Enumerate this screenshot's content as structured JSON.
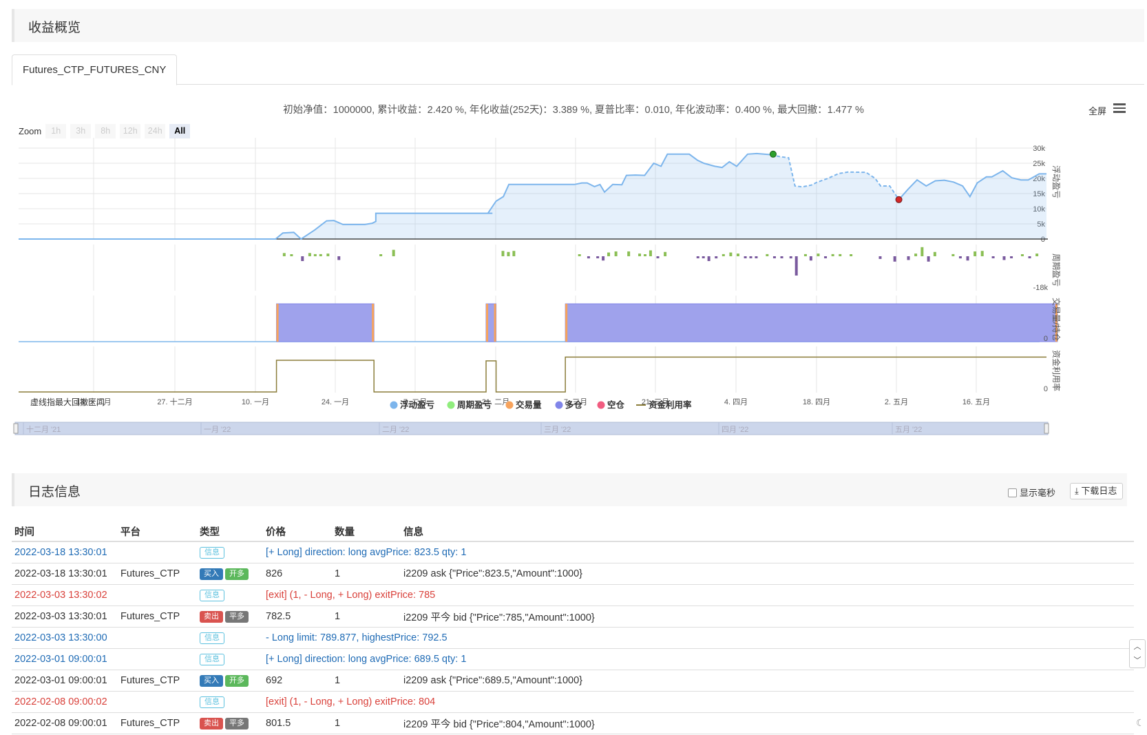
{
  "summary": {
    "title": "收益概览",
    "tab": "Futures_CTP_FUTURES_CNY",
    "stats": "初始净值：1000000, 累计收益：2.420 %, 年化收益(252天)：3.389 %, 夏普比率：0.010, 年化波动率：0.400 %, 最大回撤：1.477 %",
    "fullscreen": "全屏"
  },
  "zoom": {
    "label": "Zoom",
    "buttons": [
      "1h",
      "3h",
      "8h",
      "12h",
      "24h",
      "All"
    ],
    "active": "All"
  },
  "chart_data": {
    "type": "line",
    "x_ticks": [
      "13. 十二月",
      "27. 十二月",
      "10. 一月",
      "24. 一月",
      "7. 二月",
      "21. 二月",
      "7. 三月",
      "21. 三月",
      "4. 四月",
      "18. 四月",
      "2. 五月",
      "16. 五月"
    ],
    "navigator_ticks": [
      "十二月 '21",
      "一月 '22",
      "二月 '22",
      "三月 '22",
      "四月 '22",
      "五月 '22"
    ],
    "panes": [
      {
        "name": "浮动盈亏",
        "y_ticks": [
          "30k",
          "25k",
          "20k",
          "15k",
          "10k",
          "5k",
          "0"
        ],
        "ylim": [
          0,
          30000
        ]
      },
      {
        "name": "周期盈亏",
        "y_ticks": [
          "-18k"
        ]
      },
      {
        "name": "交易量/持仓",
        "y_ticks": [
          "0"
        ]
      },
      {
        "name": "资金利用率",
        "y_ticks": [
          "0"
        ]
      }
    ],
    "legend": [
      "浮动盈亏",
      "周期盈亏",
      "交易量",
      "多仓",
      "空仓",
      "资金利用率"
    ],
    "legend_colors": [
      "#7cb5ec",
      "#90ed7d",
      "#f7a35c",
      "#8085e9",
      "#f15c80",
      "#8b7d3a"
    ],
    "drawdown_note": "虚线指最大回撤区间",
    "floating_pnl": [
      [
        0.0,
        0
      ],
      [
        0.282,
        0
      ],
      [
        0.29,
        2000
      ],
      [
        0.302,
        2200
      ],
      [
        0.31,
        0
      ],
      [
        0.325,
        3000
      ],
      [
        0.338,
        6000
      ],
      [
        0.346,
        6100
      ],
      [
        0.356,
        4800
      ],
      [
        0.38,
        4800
      ],
      [
        0.388,
        5200
      ],
      [
        0.392,
        5800
      ],
      [
        0.392,
        8500
      ],
      [
        0.52,
        8500
      ],
      [
        0.515,
        8500
      ],
      [
        0.524,
        12500
      ],
      [
        0.532,
        14000
      ],
      [
        0.538,
        18000
      ],
      [
        0.61,
        18000
      ],
      [
        0.618,
        18500
      ],
      [
        0.624,
        18500
      ],
      [
        0.632,
        17300
      ],
      [
        0.638,
        18000
      ],
      [
        0.643,
        15500
      ],
      [
        0.652,
        18000
      ],
      [
        0.662,
        17900
      ],
      [
        0.667,
        21000
      ],
      [
        0.677,
        21100
      ],
      [
        0.687,
        21000
      ],
      [
        0.697,
        25000
      ],
      [
        0.705,
        24000
      ],
      [
        0.712,
        28000
      ],
      [
        0.736,
        28000
      ],
      [
        0.745,
        26000
      ],
      [
        0.752,
        25000
      ],
      [
        0.764,
        24000
      ],
      [
        0.772,
        23600
      ],
      [
        0.78,
        25500
      ],
      [
        0.788,
        24000
      ],
      [
        0.8,
        28000
      ],
      [
        0.81,
        28200
      ],
      [
        0.818,
        28000
      ],
      [
        0.826,
        27800
      ]
    ],
    "floating_pnl_drawdown": [
      [
        0.826,
        27800
      ],
      [
        0.835,
        27200
      ],
      [
        0.845,
        26800
      ],
      [
        0.852,
        17500
      ],
      [
        0.86,
        17200
      ],
      [
        0.87,
        17800
      ],
      [
        0.876,
        18700
      ],
      [
        0.888,
        20000
      ],
      [
        0.9,
        21600
      ],
      [
        0.91,
        22100
      ],
      [
        0.93,
        22000
      ],
      [
        0.94,
        20000
      ],
      [
        0.946,
        17500
      ],
      [
        0.956,
        17500
      ],
      [
        0.966,
        13000
      ]
    ],
    "floating_pnl_after": [
      [
        0.966,
        13000
      ],
      [
        0.976,
        16400
      ],
      [
        0.986,
        19500
      ],
      [
        0.996,
        17500
      ],
      [
        1.006,
        19200
      ],
      [
        1.016,
        19400
      ],
      [
        1.026,
        18800
      ],
      [
        1.036,
        17500
      ],
      [
        1.044,
        14000
      ],
      [
        1.052,
        18500
      ],
      [
        1.062,
        20500
      ],
      [
        1.068,
        20500
      ],
      [
        1.08,
        22500
      ],
      [
        1.09,
        20200
      ],
      [
        1.1,
        19500
      ],
      [
        1.108,
        19500
      ],
      [
        1.12,
        21500
      ],
      [
        1.128,
        21500
      ]
    ],
    "max_point": {
      "x": 0.828,
      "y": 28000,
      "color": "#2ca02c"
    },
    "min_point": {
      "x": 0.966,
      "y": 13000,
      "color": "#d62728"
    },
    "period_pnl": [
      [
        0.29,
        600,
        "pos"
      ],
      [
        0.298,
        300,
        "pos"
      ],
      [
        0.31,
        -900,
        "neg"
      ],
      [
        0.318,
        600,
        "pos"
      ],
      [
        0.324,
        400,
        "pos"
      ],
      [
        0.33,
        400,
        "pos"
      ],
      [
        0.338,
        500,
        "pos"
      ],
      [
        0.35,
        -700,
        "neg"
      ],
      [
        0.396,
        300,
        "pos"
      ],
      [
        0.41,
        1200,
        "pos"
      ],
      [
        0.53,
        1000,
        "pos"
      ],
      [
        0.536,
        800,
        "pos"
      ],
      [
        0.542,
        1000,
        "pos"
      ],
      [
        0.614,
        200,
        "pos"
      ],
      [
        0.624,
        -400,
        "neg"
      ],
      [
        0.634,
        -200,
        "neg"
      ],
      [
        0.64,
        -800,
        "neg"
      ],
      [
        0.646,
        700,
        "pos"
      ],
      [
        0.654,
        900,
        "pos"
      ],
      [
        0.668,
        900,
        "pos"
      ],
      [
        0.68,
        500,
        "pos"
      ],
      [
        0.686,
        300,
        "pos"
      ],
      [
        0.692,
        1100,
        "pos"
      ],
      [
        0.7,
        -300,
        "neg"
      ],
      [
        0.708,
        800,
        "pos"
      ],
      [
        0.744,
        -200,
        "neg"
      ],
      [
        0.75,
        -300,
        "neg"
      ],
      [
        0.756,
        -900,
        "neg"
      ],
      [
        0.764,
        -400,
        "neg"
      ],
      [
        0.772,
        400,
        "pos"
      ],
      [
        0.78,
        700,
        "pos"
      ],
      [
        0.788,
        500,
        "pos"
      ],
      [
        0.796,
        -300,
        "neg"
      ],
      [
        0.802,
        -300,
        "neg"
      ],
      [
        0.808,
        -200,
        "neg"
      ],
      [
        0.82,
        400,
        "pos"
      ],
      [
        0.828,
        -200,
        "neg"
      ],
      [
        0.836,
        -300,
        "neg"
      ],
      [
        0.846,
        -400,
        "neg"
      ],
      [
        0.852,
        -3600,
        "neg"
      ],
      [
        0.862,
        400,
        "pos"
      ],
      [
        0.868,
        -800,
        "neg"
      ],
      [
        0.876,
        500,
        "pos"
      ],
      [
        0.884,
        -300,
        "neg"
      ],
      [
        0.892,
        400,
        "pos"
      ],
      [
        0.9,
        400,
        "pos"
      ],
      [
        0.912,
        300,
        "pos"
      ],
      [
        0.944,
        -500,
        "neg"
      ],
      [
        0.96,
        -1000,
        "neg"
      ],
      [
        0.975,
        -700,
        "neg"
      ],
      [
        0.983,
        500,
        "pos"
      ],
      [
        0.99,
        1700,
        "pos"
      ],
      [
        0.997,
        -1000,
        "neg"
      ],
      [
        1.004,
        800,
        "pos"
      ],
      [
        1.024,
        400,
        "pos"
      ],
      [
        1.032,
        -400,
        "neg"
      ],
      [
        1.04,
        -800,
        "neg"
      ],
      [
        1.048,
        900,
        "pos"
      ],
      [
        1.056,
        1000,
        "pos"
      ],
      [
        1.068,
        -300,
        "neg"
      ],
      [
        1.08,
        -700,
        "neg"
      ],
      [
        1.088,
        -200,
        "neg"
      ],
      [
        1.1,
        300,
        "pos"
      ],
      [
        1.108,
        -300,
        "neg"
      ],
      [
        1.116,
        500,
        "pos"
      ]
    ],
    "position_blocks": [
      [
        0.283,
        0.39
      ],
      [
        0.513,
        0.524
      ],
      [
        0.6,
        1.14
      ]
    ],
    "utilization": [
      [
        0.0,
        0
      ],
      [
        0.283,
        0
      ],
      [
        0.283,
        1
      ],
      [
        0.39,
        1
      ],
      [
        0.39,
        0
      ],
      [
        0.513,
        0
      ],
      [
        0.513,
        0.98
      ],
      [
        0.524,
        0.98
      ],
      [
        0.524,
        0
      ],
      [
        0.6,
        0
      ],
      [
        0.6,
        1.1
      ],
      [
        1.128,
        1.1
      ]
    ]
  },
  "log": {
    "title": "日志信息",
    "show_ms": "显示毫秒",
    "download": "下载日志",
    "headers": {
      "time": "时间",
      "platform": "平台",
      "type": "类型",
      "price": "价格",
      "qty": "数量",
      "info": "信息"
    },
    "rows": [
      {
        "time": "2022-03-18 13:30:01",
        "platform": "",
        "badges": [
          [
            "信息",
            "info"
          ]
        ],
        "price": "",
        "qty": "",
        "info": "[+ Long] direction: long avgPrice: 823.5 qty: 1",
        "color": "blue",
        "span": true
      },
      {
        "time": "2022-03-18 13:30:01",
        "platform": "Futures_CTP",
        "badges": [
          [
            "买入",
            "buy"
          ],
          [
            "开多",
            "open"
          ]
        ],
        "price": "826",
        "qty": "1",
        "info": "i2209 ask {\"Price\":823.5,\"Amount\":1000}",
        "color": "",
        "span": false
      },
      {
        "time": "2022-03-03 13:30:02",
        "platform": "",
        "badges": [
          [
            "信息",
            "info"
          ]
        ],
        "price": "",
        "qty": "",
        "info": "[exit] (1, - Long, + Long) exitPrice: 785",
        "color": "red",
        "span": true
      },
      {
        "time": "2022-03-03 13:30:01",
        "platform": "Futures_CTP",
        "badges": [
          [
            "卖出",
            "sell"
          ],
          [
            "平多",
            "close"
          ]
        ],
        "price": "782.5",
        "qty": "1",
        "info": "i2209 平今 bid {\"Price\":785,\"Amount\":1000}",
        "color": "",
        "span": false
      },
      {
        "time": "2022-03-03 13:30:00",
        "platform": "",
        "badges": [
          [
            "信息",
            "info"
          ]
        ],
        "price": "",
        "qty": "",
        "info": "- Long limit: 789.877, highestPrice: 792.5",
        "color": "blue",
        "span": true
      },
      {
        "time": "2022-03-01 09:00:01",
        "platform": "",
        "badges": [
          [
            "信息",
            "info"
          ]
        ],
        "price": "",
        "qty": "",
        "info": "[+ Long] direction: long avgPrice: 689.5 qty: 1",
        "color": "blue",
        "span": true
      },
      {
        "time": "2022-03-01 09:00:01",
        "platform": "Futures_CTP",
        "badges": [
          [
            "买入",
            "buy"
          ],
          [
            "开多",
            "open"
          ]
        ],
        "price": "692",
        "qty": "1",
        "info": "i2209 ask {\"Price\":689.5,\"Amount\":1000}",
        "color": "",
        "span": false
      },
      {
        "time": "2022-02-08 09:00:02",
        "platform": "",
        "badges": [
          [
            "信息",
            "info"
          ]
        ],
        "price": "",
        "qty": "",
        "info": "[exit] (1, - Long, + Long) exitPrice: 804",
        "color": "red",
        "span": true
      },
      {
        "time": "2022-02-08 09:00:01",
        "platform": "Futures_CTP",
        "badges": [
          [
            "卖出",
            "sell"
          ],
          [
            "平多",
            "close"
          ]
        ],
        "price": "801.5",
        "qty": "1",
        "info": "i2209 平今 bid {\"Price\":804,\"Amount\":1000}",
        "color": "",
        "span": false
      }
    ]
  }
}
